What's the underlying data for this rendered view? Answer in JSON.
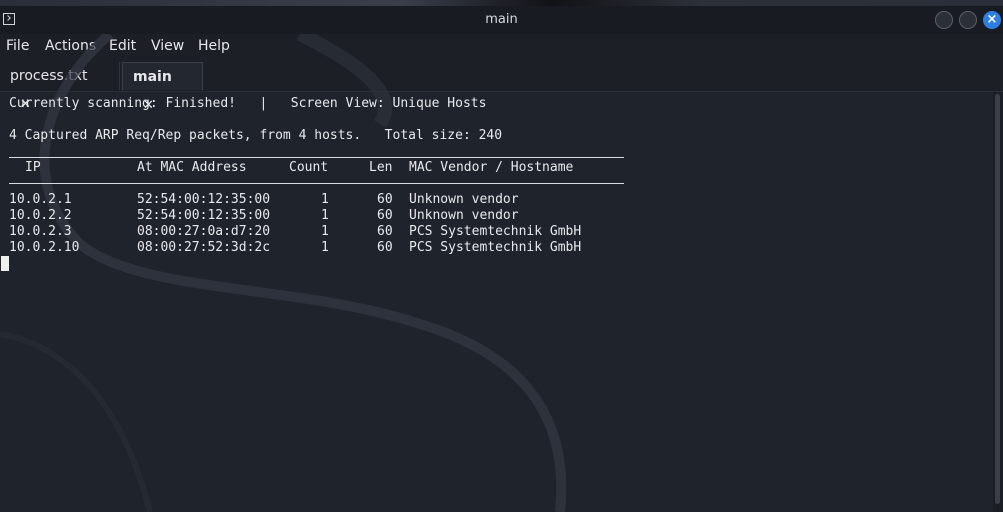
{
  "window": {
    "title": "main"
  },
  "menu": [
    "File",
    "Actions",
    "Edit",
    "View",
    "Help"
  ],
  "tabs": [
    {
      "label": "process.txt",
      "close": "✕",
      "active": false
    },
    {
      "label": "main",
      "close": "✕",
      "active": true
    }
  ],
  "terminal": {
    "status_line": "Currently scanning: Finished!   |   Screen View: Unique Hosts",
    "summary_line": "4 Captured ARP Req/Rep packets, from 4 hosts.   Total size: 240",
    "headers": [
      "IP",
      "At MAC Address",
      "Count",
      "Len",
      "MAC Vendor / Hostname"
    ],
    "rows": [
      [
        "10.0.2.1",
        "52:54:00:12:35:00",
        "1",
        "60",
        "Unknown vendor"
      ],
      [
        "10.0.2.2",
        "52:54:00:12:35:00",
        "1",
        "60",
        "Unknown vendor"
      ],
      [
        "10.0.2.3",
        "08:00:27:0a:d7:20",
        "1",
        "60",
        "PCS Systemtechnik GmbH"
      ],
      [
        "10.0.2.10",
        "08:00:27:52:3d:2c",
        "1",
        "60",
        "PCS Systemtechnik GmbH"
      ]
    ]
  },
  "colors": {
    "accent": "#2f7fe0",
    "background": "#1f232c",
    "text": "#e7e9ec"
  },
  "icons": {
    "app": "terminal-icon",
    "close_window": "close-icon"
  }
}
